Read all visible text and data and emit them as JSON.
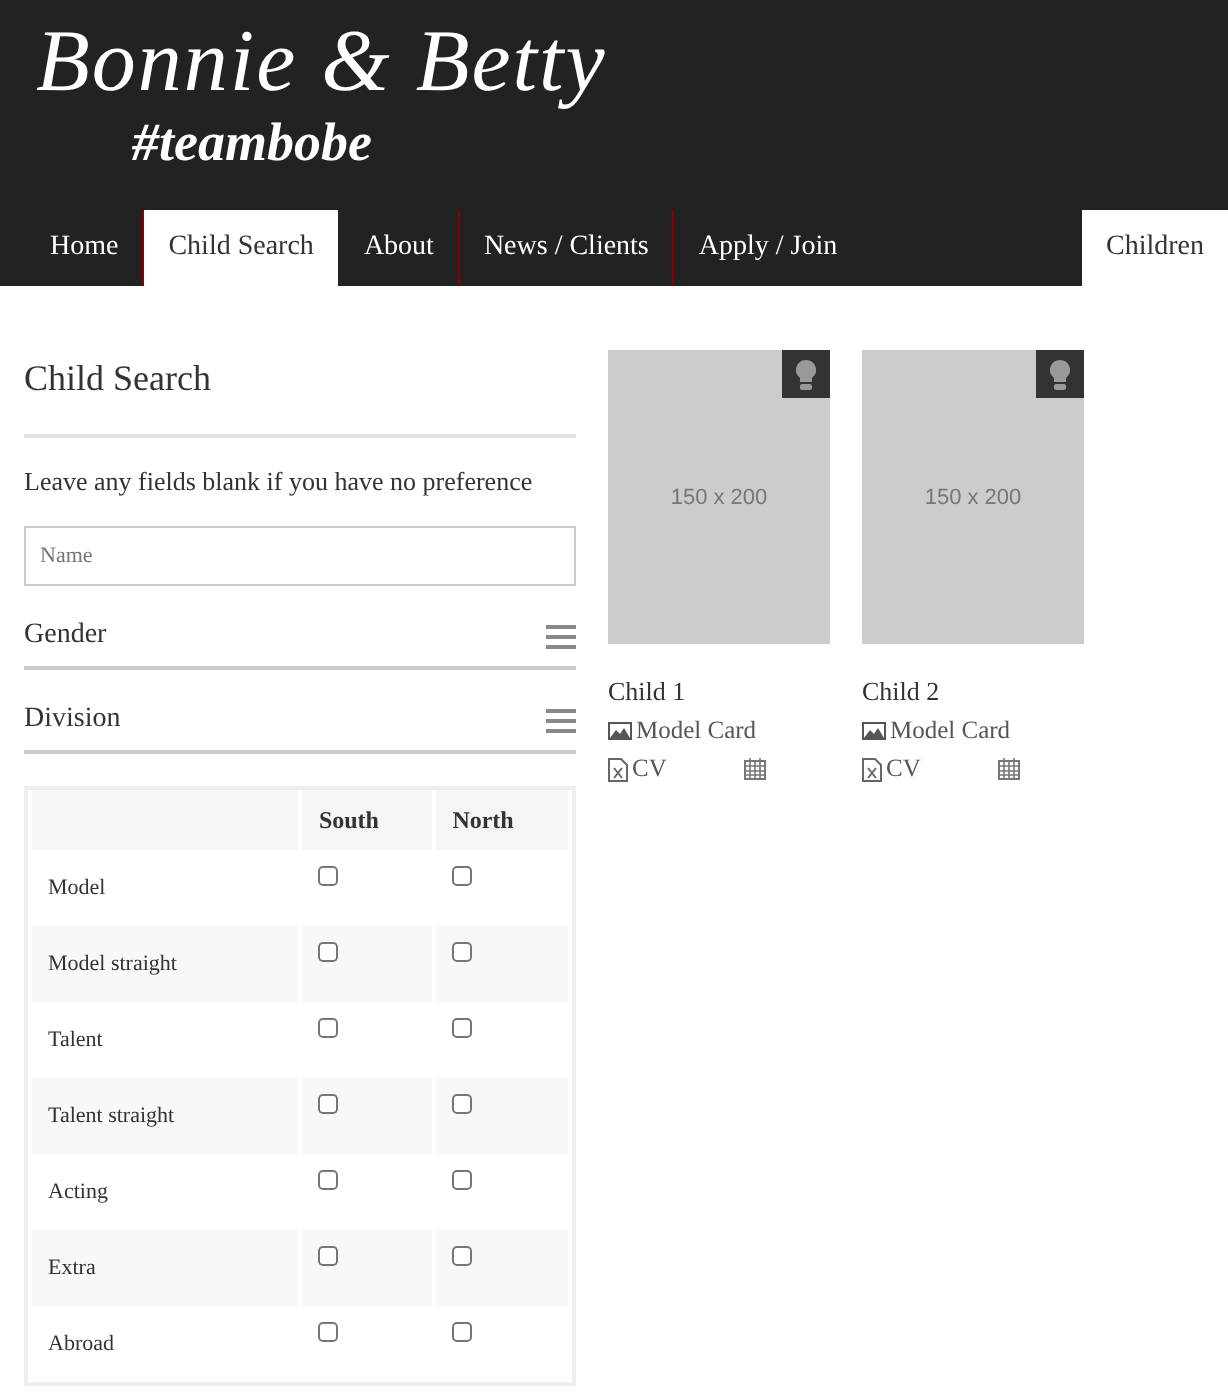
{
  "logo": {
    "title": "Bonnie & Betty",
    "tagline": "#teambobe"
  },
  "nav": [
    {
      "label": "Home",
      "selected": false
    },
    {
      "label": "Child Search",
      "selected": true
    },
    {
      "label": "About",
      "selected": false
    },
    {
      "label": "News / Clients",
      "selected": false
    },
    {
      "label": "Apply / Join",
      "selected": false
    }
  ],
  "nav_right": {
    "label": "Children",
    "selected": true
  },
  "search": {
    "title": "Child Search",
    "note": "Leave any fields blank if you have no preference",
    "name_field": {
      "placeholder": "Name"
    },
    "filters": [
      {
        "label": "Gender",
        "expanded": false
      },
      {
        "label": "Division",
        "expanded": false
      }
    ],
    "table": {
      "columns": [
        "South",
        "North"
      ],
      "rows": [
        {
          "label": "Model",
          "south": false,
          "north": false
        },
        {
          "label": "Model straight",
          "south": false,
          "north": false
        },
        {
          "label": "Talent",
          "south": false,
          "north": false
        },
        {
          "label": "Talent straight",
          "south": false,
          "north": false
        },
        {
          "label": "Acting",
          "south": false,
          "north": false
        },
        {
          "label": "Extra",
          "south": false,
          "north": false
        },
        {
          "label": "Abroad",
          "south": false,
          "north": false
        }
      ]
    }
  },
  "children": [
    {
      "image_text": "150 x 200",
      "name": "Child 1",
      "model_card": "Model Card",
      "cv": "CV"
    },
    {
      "image_text": "150 x 200",
      "name": "Child 2",
      "model_card": "Model Card",
      "cv": "CV"
    }
  ]
}
